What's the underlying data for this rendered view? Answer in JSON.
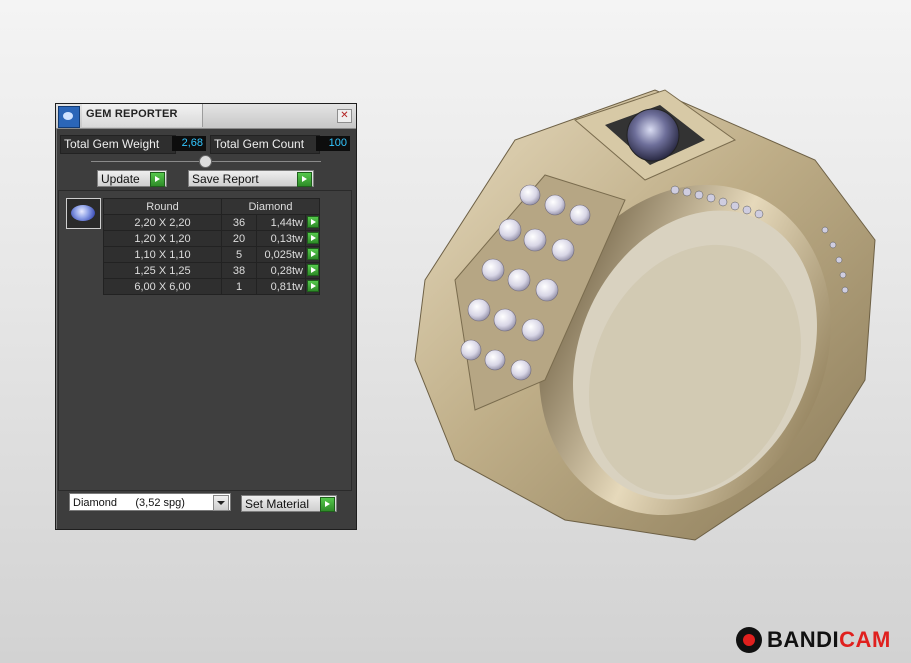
{
  "panel": {
    "title": "GEM REPORTER",
    "close_symbol": "✕",
    "total_weight_label": "Total Gem Weight",
    "total_weight_value": "2,68",
    "total_count_label": "Total Gem Count",
    "total_count_value": "100",
    "update_label": "Update",
    "save_report_label": "Save Report",
    "table": {
      "shape_header": "Round",
      "material_header": "Diamond",
      "rows": [
        {
          "size": "2,20 X 2,20",
          "count": "36",
          "weight": "1,44tw"
        },
        {
          "size": "1,20 X 1,20",
          "count": "20",
          "weight": "0,13tw"
        },
        {
          "size": "1,10 X 1,10",
          "count": "5",
          "weight": "0,025tw"
        },
        {
          "size": "1,25 X 1,25",
          "count": "38",
          "weight": "0,28tw"
        },
        {
          "size": "6,00 X 6,00",
          "count": "1",
          "weight": "0,81tw"
        }
      ]
    },
    "material_select": "Diamond      (3,52 spg)",
    "set_material_label": "Set Material"
  },
  "watermark": {
    "part1": "BANDI",
    "part2": "CAM"
  },
  "colors": {
    "panel_bg": "#3d3d3d",
    "value_text": "#33c6ff",
    "go_button": "#3fae36",
    "ring_metal": "#c9bb9a",
    "record_red": "#e0201e"
  },
  "icons": {
    "app_icon": "gem-reporter-icon",
    "close": "close-icon",
    "go": "green-play-arrow-icon",
    "gem": "round-diamond-icon",
    "dropdown": "chevron-down-icon",
    "record": "record-icon"
  }
}
